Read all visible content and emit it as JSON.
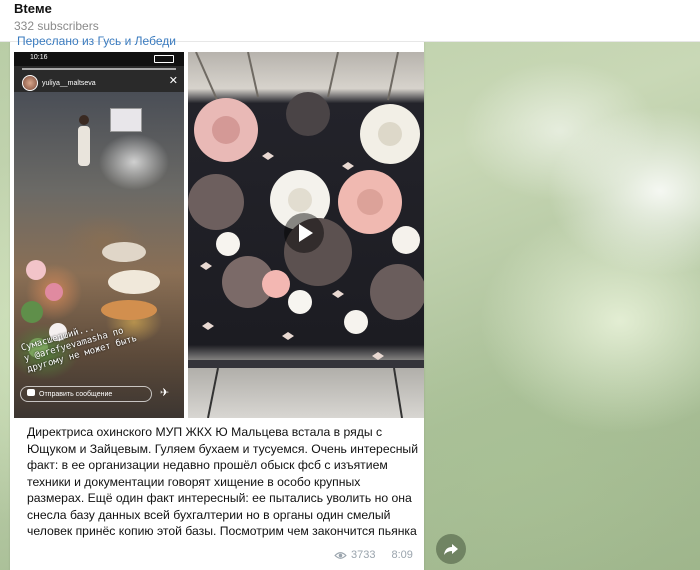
{
  "header": {
    "title": "Вteме",
    "subscribers": "332 subscribers"
  },
  "message": {
    "forwarded_from": "Переслано из Гусь и Лебеди",
    "story": {
      "time": "10:16",
      "username": "yuliya__maltseva",
      "caption_line1": "Сумасшедший...",
      "caption_line2": "у @arefyevamasha по",
      "caption_line3": "другому не может быть",
      "reply_placeholder": "Отправить сообщение"
    },
    "text": "Директриса охинского МУП ЖКХ Ю Мальцева встала в ряды с Ющуком и Зайцевым. Гуляем бухаем и тусуемся. Очень интересный факт: в ее организации недавно прошёл обыск фсб с изъятием техники и документации говорят хищение в особо крупных размерах. Ещё один факт интересный: ее пытались уволить но она снесла базу данных всей бухгалтерии но в органы один смелый человек принёс копию этой базы. Посмотрим чем закончится пьянка",
    "views": "3733",
    "time": "8:09"
  },
  "icons": {
    "views": "eye-icon",
    "share": "share-arrow-icon",
    "play": "play-icon"
  },
  "colors": {
    "link": "#3a7bbf",
    "meta": "#9aa4ad"
  }
}
